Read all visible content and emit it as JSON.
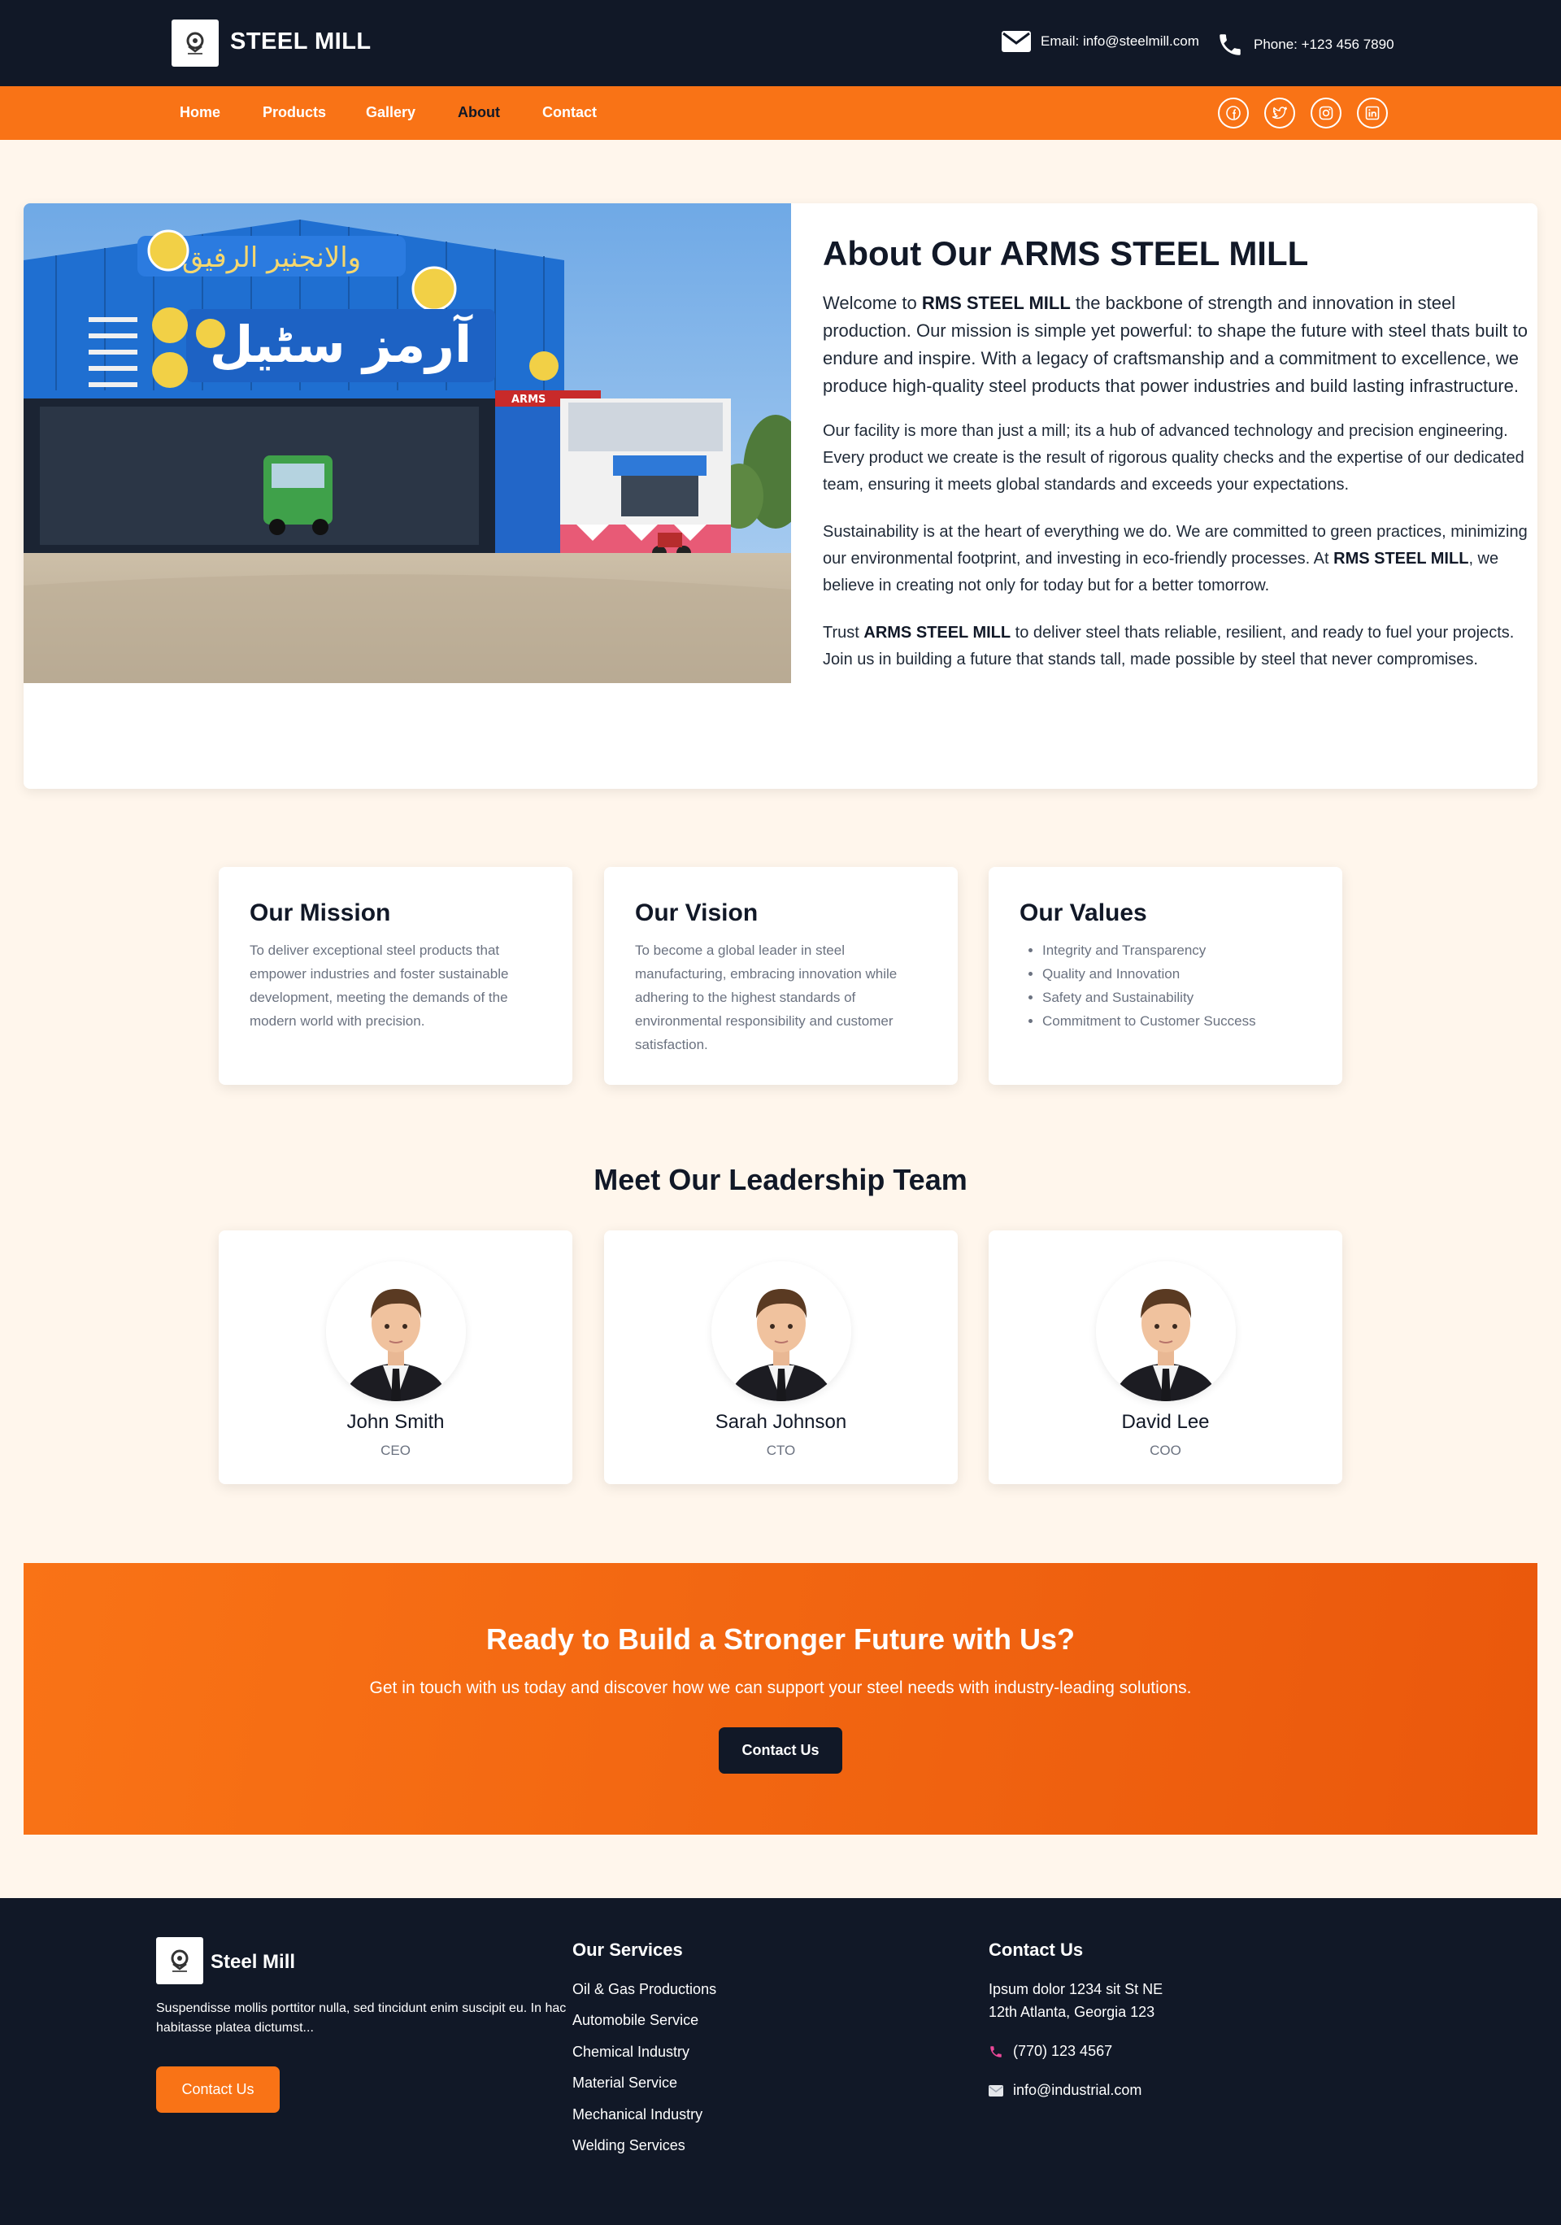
{
  "colors": {
    "dark": "#111827",
    "accent": "#f97316",
    "accent_dark": "#ea580c",
    "page_bg": "#fff6ec"
  },
  "header": {
    "brand": "STEEL MILL",
    "logo_icon": "gear-arms-logo-icon",
    "email_icon": "envelope-icon",
    "email": "Email: info@steelmill.com",
    "phone_icon": "phone-icon",
    "phone": "Phone: +123 456 7890"
  },
  "nav": {
    "items": [
      {
        "label": "Home"
      },
      {
        "label": "Products"
      },
      {
        "label": "Gallery"
      },
      {
        "label": "About",
        "active": true
      },
      {
        "label": "Contact"
      }
    ],
    "social": [
      "facebook-icon",
      "twitter-icon",
      "instagram-icon",
      "linkedin-icon"
    ]
  },
  "about": {
    "image_alt": "ARMS Steel mill building",
    "title": "About Our ARMS STEEL MILL",
    "lead_prefix": "Welcome to ",
    "lead_bold": "RMS STEEL MILL",
    "lead_suffix": " the backbone of strength and innovation in steel production. Our mission is simple yet powerful: to shape the future with steel thats built to endure and inspire. With a legacy of craftsmanship and a commitment to excellence, we produce high-quality steel products that power industries and build lasting infrastructure.",
    "p2": "Our facility is more than just a mill; its a hub of advanced technology and precision engineering. Every product we create is the result of rigorous quality checks and the expertise of our dedicated team, ensuring it meets global standards and exceeds your expectations.",
    "p3_prefix": "Sustainability is at the heart of everything we do. We are committed to green practices, minimizing our environmental footprint, and investing in eco-friendly processes. At ",
    "p3_bold": "RMS STEEL MILL",
    "p3_suffix": ", we believe in creating not only for today but for a better tomorrow.",
    "p4_prefix": "Trust ",
    "p4_bold": "ARMS STEEL MILL",
    "p4_suffix": " to deliver steel thats reliable, resilient, and ready to fuel your projects. Join us in building a future that stands tall, made possible by steel that never compromises."
  },
  "mission": {
    "title": "Our Mission",
    "text": "To deliver exceptional steel products that empower industries and foster sustainable development, meeting the demands of the modern world with precision."
  },
  "vision": {
    "title": "Our Vision",
    "text": "To become a global leader in steel manufacturing, embracing innovation while adhering to the highest standards of environmental responsibility and customer satisfaction."
  },
  "values": {
    "title": "Our Values",
    "items": [
      "Integrity and Transparency",
      "Quality and Innovation",
      "Safety and Sustainability",
      "Commitment to Customer Success"
    ]
  },
  "team": {
    "heading": "Meet Our Leadership Team",
    "members": [
      {
        "name": "John Smith",
        "role": "CEO"
      },
      {
        "name": "Sarah Johnson",
        "role": "CTO"
      },
      {
        "name": "David Lee",
        "role": "COO"
      }
    ]
  },
  "cta": {
    "title": "Ready to Build a Stronger Future with Us?",
    "subtitle": "Get in touch with us today and discover how we can support your steel needs with industry-leading solutions.",
    "button": "Contact Us"
  },
  "footer": {
    "brand": "Steel Mill",
    "description": "Suspendisse mollis porttitor nulla, sed tincidunt enim suscipit eu. In hac habitasse platea dictumst...",
    "button": "Contact Us",
    "services_title": "Our Services",
    "services": [
      "Oil & Gas Productions",
      "Automobile Service",
      "Chemical Industry",
      "Material Service",
      "Mechanical Industry",
      "Welding Services"
    ],
    "contact_title": "Contact Us",
    "address_line1": "Ipsum dolor 1234 sit St NE",
    "address_line2": "12th Atlanta, Georgia 123",
    "phone": "(770) 123 4567",
    "email": "info@industrial.com"
  }
}
